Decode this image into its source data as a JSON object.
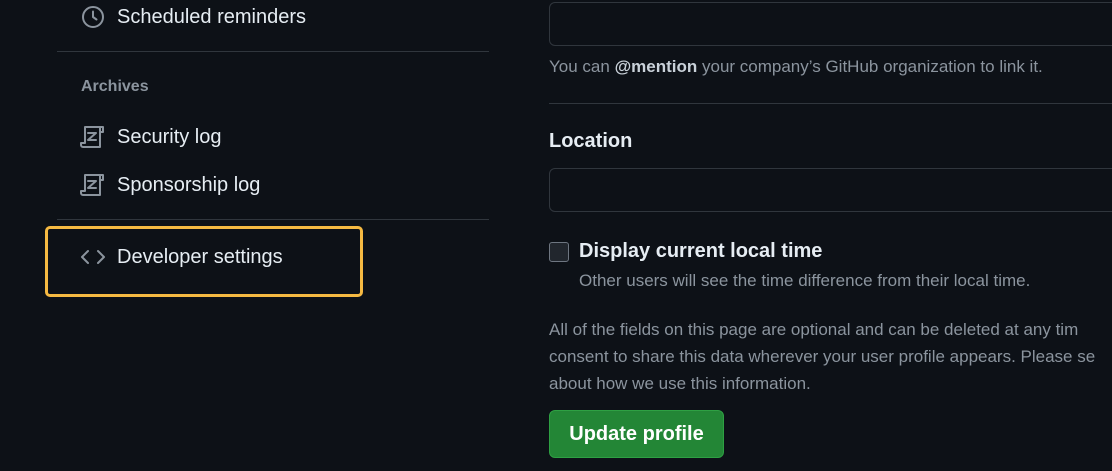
{
  "sidebar": {
    "scheduled_reminders": {
      "label": "Scheduled reminders",
      "icon": "clock-icon"
    },
    "archives_heading": "Archives",
    "archive_items": [
      {
        "label": "Security log",
        "icon": "log-icon"
      },
      {
        "label": "Sponsorship log",
        "icon": "log-icon"
      }
    ],
    "developer_settings": {
      "label": "Developer settings",
      "icon": "code-icon",
      "highlighted": true
    }
  },
  "main": {
    "company": {
      "value": "",
      "note_prefix": "You can",
      "note_mention": "@mention",
      "note_suffix": "your company’s GitHub organization to link it."
    },
    "location": {
      "label": "Location",
      "value": ""
    },
    "local_time": {
      "label": "Display current local time",
      "hint": "Other users will see the time difference from their local time.",
      "checked": false
    },
    "info_lines": [
      "All of the fields on this page are optional and can be deleted at any tim",
      "consent to share this data wherever your user profile appears. Please se",
      "about how we use this information."
    ],
    "update_button_label": "Update profile"
  },
  "colors": {
    "background": "#0d1117",
    "highlight": "#f5b942",
    "primary_button": "#238636",
    "muted_text": "#8b949e"
  }
}
